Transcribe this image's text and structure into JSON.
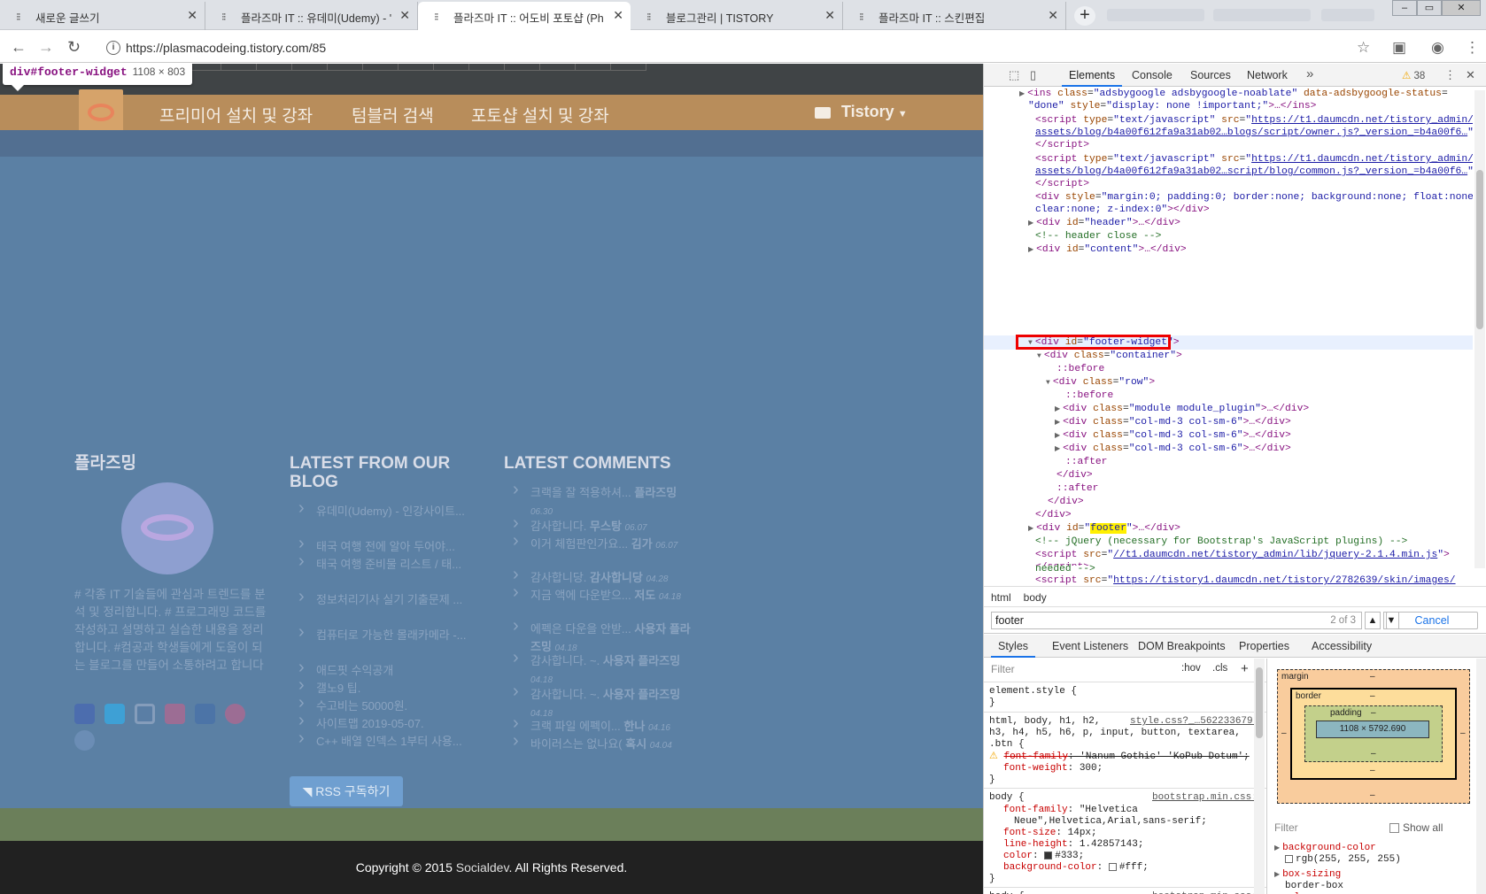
{
  "tabs": [
    {
      "title": "새로운 글쓰기"
    },
    {
      "title": "플라즈마 IT :: 유데미(Udemy) - '"
    },
    {
      "title": "플라즈마 IT :: 어도비 포토샵 (Ph"
    },
    {
      "title": "블로그관리 | TISTORY"
    },
    {
      "title": "플라즈마 IT :: 스킨편집"
    }
  ],
  "address": {
    "url": "https://plasmacodeing.tistory.com/85"
  },
  "inspect_tooltip": {
    "selector": "div#footer-widget",
    "size": "1108 × 803"
  },
  "site_nav": {
    "links": [
      "프리미어 설치 및 강좌",
      "텀블러 검색",
      "포토샵 설치 및 강좌"
    ],
    "dropdown": "Tistory"
  },
  "footer": {
    "col1": {
      "heading": "플라즈밍",
      "description": "# 각종 IT 기술들에 관심과 트렌드를 분석 및 정리합니다. # 프로그래밍 코드를 작성하고 설명하고 실습한 내용을 정리합니다. #컴공과 학생들에게 도움이 되는 블로그를 만들어 소통하려고 합니다"
    },
    "col2": {
      "heading": "LATEST FROM OUR BLOG",
      "posts": [
        "유데미(Udemy) - 인강사이트...",
        "태국 여행 전에 알아 두어야...",
        "태국 여행 준비물 리스트 / 태...",
        "정보처리기사 실기 기출문제 ...",
        "컴퓨터로 가능한 몰래카메라 -...",
        "애드핏 수익공개",
        "갤노9 팁.",
        "수고비는 50000원.",
        "사이트맵 2019-05-07.",
        "C++ 배열 인덱스 1부터 사용..."
      ],
      "rss_label": "RSS 구독하기"
    },
    "col3": {
      "heading": "LATEST COMMENTS",
      "comments": [
        {
          "text": "크랙을 잘 적용하셔... ",
          "author": "플라즈밍",
          "date": "06.30"
        },
        {
          "text": "감사합니다. ",
          "author": "무스탕",
          "date": "06.07"
        },
        {
          "text": "이거 체험판인가요... ",
          "author": "김가",
          "date": "06.07"
        },
        {
          "text": "감사합니당. ",
          "author": "감사합니당",
          "date": "04.28"
        },
        {
          "text": "지금 액에 다운받으... ",
          "author": "저도",
          "date": "04.18"
        },
        {
          "text": "에펙은 다운을 안받... ",
          "author": "사용자 플라즈밍",
          "date": "04.18"
        },
        {
          "text": "감사합니다. ~. ",
          "author": "사용자 플라즈밍",
          "date": "04.18"
        },
        {
          "text": "감사합니다. ~. ",
          "author": "사용자 플라즈밍",
          "date": "04.18"
        },
        {
          "text": "크랙 파일 에펙이... ",
          "author": "한나",
          "date": "04.16"
        },
        {
          "text": "바이러스는 없나요( ",
          "author": "혹시",
          "date": "04.04"
        }
      ]
    },
    "copyright_pre": "Copyright © 2015 ",
    "copyright_link": "Socialdev",
    "copyright_post": ". All Rights Reserved."
  },
  "devtools": {
    "tabs": [
      "Elements",
      "Console",
      "Sources",
      "Network"
    ],
    "warnings": "38",
    "breadcrumbs": [
      "html",
      "body"
    ],
    "search": {
      "value": "footer",
      "count": "2 of 3",
      "cancel": "Cancel"
    },
    "subtabs": [
      "Styles",
      "Event Listeners",
      "DOM Breakpoints",
      "Properties",
      "Accessibility"
    ],
    "filter_placeholder": "Filter",
    "hov": ":hov",
    "cls": ".cls",
    "boxmodel": {
      "margin": "margin",
      "border": "border",
      "padding": "padding",
      "content": "1108 × 5792.690",
      "dash": "–"
    },
    "computed_filter": "Filter",
    "show_all": "Show all"
  }
}
